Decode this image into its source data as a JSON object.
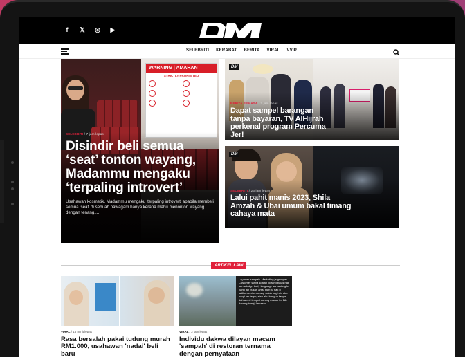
{
  "site": {
    "logo_text": "DM",
    "social_icons": [
      "facebook-icon",
      "twitter-icon",
      "instagram-icon",
      "youtube-icon"
    ],
    "social_glyphs": [
      "f",
      "𝕏",
      "◎",
      "▶"
    ]
  },
  "nav": {
    "items": [
      "SELEBRITI",
      "KERABAT",
      "BERITA",
      "VIRAL",
      "VVIP"
    ]
  },
  "featured": {
    "category": "SELEBRITI",
    "time": "7 jam lepas",
    "headline": "Disindir beli semua ‘seat’ tonton wayang, Madammu mengaku ‘terpaling introvert’",
    "description": "Usahawan kosmetik, Madammu mengaku 'terpaling introvert' apabila membeli semua 'seat' di sebuah pawagam hanya kerana mahu menonton wayang dengan tenang....",
    "sign_title": "WARNING | AMARAN",
    "sign_subtitle": "STRICTLY PROHIBITED"
  },
  "side_top": {
    "category": "BERITA SEMASA",
    "time": "7 jam lepas",
    "headline": "Dapat sampel barangan tanpa bayaran, TV AlHijrah perkenal program Percuma Jer!",
    "badge": "DM"
  },
  "side_bottom": {
    "category": "SELEBRITI",
    "time": "23 jam lepas",
    "headline": "Lalui pahit manis 2023, Shila Amzah & Ubai umum bakal timang cahaya mata",
    "badge": "DM"
  },
  "section": {
    "label": "ARTIKEL LAIN"
  },
  "bottom_articles": [
    {
      "category": "VIRAL",
      "time": "16 minit lepas",
      "headline": "Rasa bersalah pakai tudung murah RM1.000, usahawan 'nadai' beli baru"
    },
    {
      "category": "VIRAL",
      "time": "2 jam lepas",
      "headline": "Individu dakwa dilayan macam 'sampah' di restoran ternama dengan pernyataan",
      "text_overlay": "Layanan sampah. Marketing je gempak. Customer tanya soalan dorang balas nak tak nak dgn body language sarcastic gile. Tahu lah bukan artis. Hari tu nak ill jadikan cerita dorang salah bagi air, aku pergi lah tegur, siap aku bangun tanpa dah ambil tempat dorang masuk tu. Bib dorang buruj. Lepastu"
    }
  ]
}
